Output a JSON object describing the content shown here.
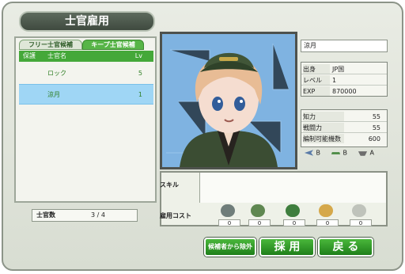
{
  "title": "士官雇用",
  "tabs": [
    {
      "label": "フリー士官候補"
    },
    {
      "label": "キープ士官候補"
    }
  ],
  "list_header": {
    "guard": "保護",
    "name": "士官名",
    "level": "Lv"
  },
  "officers": [
    {
      "name": "ロック",
      "level": "5"
    },
    {
      "name": "涼月",
      "level": "1"
    }
  ],
  "officer_count": {
    "label": "士官数",
    "value": "3 / 4"
  },
  "profile": {
    "name": "涼月",
    "origin_label": "出身",
    "origin": "JP国",
    "level_label": "レベル",
    "level": "1",
    "exp_label": "EXP",
    "exp": "870000",
    "intelligence_label": "知力",
    "intelligence": "55",
    "combat_label": "戦闘力",
    "combat": "55",
    "formation_label": "編制可能機数",
    "formation": "600"
  },
  "unit_ranks": [
    {
      "icon": "fighter-icon",
      "value": "B"
    },
    {
      "icon": "transport-icon",
      "value": "B"
    },
    {
      "icon": "bomber-icon",
      "value": "A"
    }
  ],
  "skill": {
    "label": "スキル"
  },
  "hire_cost": {
    "label": "雇用コスト",
    "items": [
      {
        "icon": "fuel-icon",
        "value": "0"
      },
      {
        "icon": "ammo-icon",
        "value": "0"
      },
      {
        "icon": "soldier-icon",
        "value": "0"
      },
      {
        "icon": "supply-icon",
        "value": "0"
      },
      {
        "icon": "coin-icon",
        "value": "0"
      }
    ]
  },
  "buttons": {
    "exclude": "候補者から除外",
    "hire": "採 用",
    "back": "戻 る"
  },
  "colors": {
    "primary_green": "#3ba632",
    "selected_row": "#9fd6f5",
    "portrait_bg": "#7fb3e1"
  }
}
